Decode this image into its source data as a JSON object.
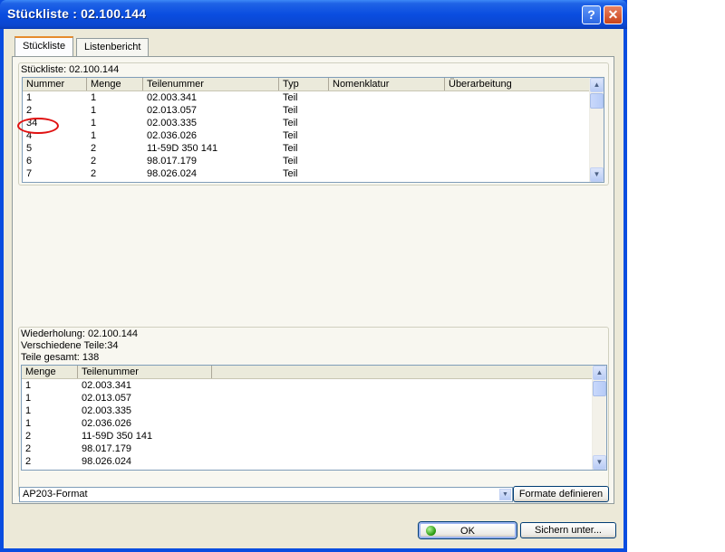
{
  "window": {
    "title": "Stückliste : 02.100.144",
    "help_symbol": "?",
    "close_symbol": "✕"
  },
  "tabs": [
    {
      "label": "Stückliste"
    },
    {
      "label": "Listenbericht"
    }
  ],
  "top_group": {
    "label": "Stückliste: 02.100.144",
    "columns": [
      "Nummer",
      "Menge",
      "Teilenummer",
      "Typ",
      "Nomenklatur",
      "Überarbeitung"
    ],
    "rows": [
      [
        "1",
        "1",
        "02.003.341",
        "Teil",
        "",
        ""
      ],
      [
        "2",
        "1",
        "02.013.057",
        "Teil",
        "",
        ""
      ],
      [
        "34",
        "1",
        "02.003.335",
        "Teil",
        "",
        ""
      ],
      [
        "4",
        "1",
        "02.036.026",
        "Teil",
        "",
        ""
      ],
      [
        "5",
        "2",
        "11-59D 350 141",
        "Teil",
        "",
        ""
      ],
      [
        "6",
        "2",
        "98.017.179",
        "Teil",
        "",
        ""
      ],
      [
        "7",
        "2",
        "98.026.024",
        "Teil",
        "",
        ""
      ]
    ]
  },
  "bottom_group": {
    "line1": "Wiederholung: 02.100.144",
    "line2": "Verschiedene Teile:34",
    "line3": "Teile gesamt: 138",
    "columns": [
      "Menge",
      "Teilenummer"
    ],
    "rows": [
      [
        "1",
        "02.003.341"
      ],
      [
        "1",
        "02.013.057"
      ],
      [
        "1",
        "02.003.335"
      ],
      [
        "1",
        "02.036.026"
      ],
      [
        "2",
        "11-59D 350 141"
      ],
      [
        "2",
        "98.017.179"
      ],
      [
        "2",
        "98.026.024"
      ]
    ]
  },
  "format": {
    "value": "AP203-Format",
    "define_label": "Formate definieren"
  },
  "buttons": {
    "ok_label": "OK",
    "save_label": "Sichern unter..."
  }
}
